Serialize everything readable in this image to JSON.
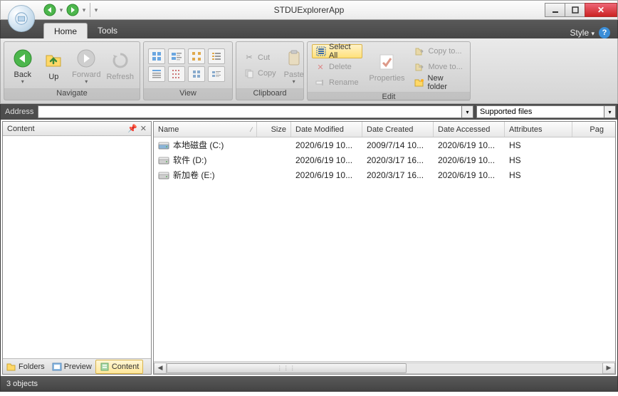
{
  "window": {
    "title": "STDUExplorerApp"
  },
  "tabs": {
    "home": "Home",
    "tools": "Tools",
    "style": "Style"
  },
  "ribbon": {
    "navigate": {
      "label": "Navigate",
      "back": "Back",
      "up": "Up",
      "forward": "Forward",
      "refresh": "Refresh"
    },
    "view": {
      "label": "View"
    },
    "clipboard": {
      "label": "Clipboard",
      "cut": "Cut",
      "copy": "Copy",
      "paste": "Paste"
    },
    "edit": {
      "label": "Edit",
      "select_all": "Select All",
      "delete": "Delete",
      "rename": "Rename",
      "properties": "Properties",
      "copy_to": "Copy to...",
      "move_to": "Move to...",
      "new_folder": "New folder"
    }
  },
  "address": {
    "label": "Address",
    "value": "",
    "filter": "Supported files"
  },
  "leftpane": {
    "title": "Content",
    "tabs": {
      "folders": "Folders",
      "preview": "Preview",
      "content": "Content"
    }
  },
  "columns": {
    "name": "Name",
    "size": "Size",
    "date_modified": "Date Modified",
    "date_created": "Date Created",
    "date_accessed": "Date Accessed",
    "attributes": "Attributes",
    "pages": "Pag"
  },
  "rows": [
    {
      "icon": "hdd",
      "name": "本地磁盘 (C:)",
      "size": "",
      "dm": "2020/6/19 10...",
      "dc": "2009/7/14 10...",
      "da": "2020/6/19 10...",
      "attr": "HS"
    },
    {
      "icon": "hdd-gray",
      "name": "软件 (D:)",
      "size": "",
      "dm": "2020/6/19 10...",
      "dc": "2020/3/17 16...",
      "da": "2020/6/19 10...",
      "attr": "HS"
    },
    {
      "icon": "hdd-gray",
      "name": "新加卷 (E:)",
      "size": "",
      "dm": "2020/6/19 10...",
      "dc": "2020/3/17 16...",
      "da": "2020/6/19 10...",
      "attr": "HS"
    }
  ],
  "status": {
    "text": "3 objects"
  }
}
